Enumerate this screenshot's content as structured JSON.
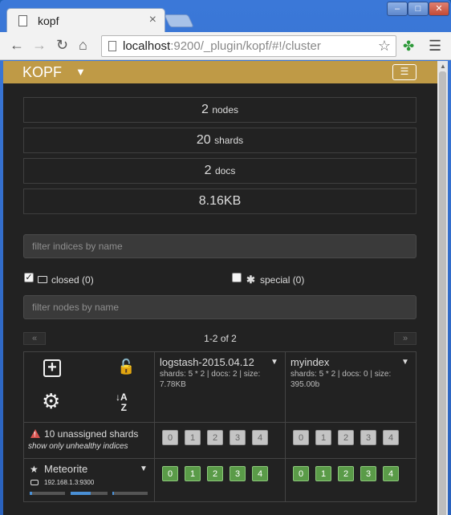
{
  "browser": {
    "tab_title": "kopf",
    "url_host": "localhost",
    "url_path": ":9200/_plugin/kopf/#!/cluster"
  },
  "app": {
    "brand": "KOPF"
  },
  "stats": {
    "nodes": {
      "value": "2",
      "unit": "nodes"
    },
    "shards": {
      "value": "20",
      "unit": "shards"
    },
    "docs": {
      "value": "2",
      "unit": "docs"
    },
    "size": {
      "value": "8.16KB"
    }
  },
  "filters": {
    "indices_placeholder": "filter indices by name",
    "nodes_placeholder": "filter nodes by name",
    "closed_label": "closed (0)",
    "closed_checked": true,
    "special_label": "special (0)",
    "special_checked": false
  },
  "pager": {
    "prev": "«",
    "next": "»",
    "text": "1-2 of 2"
  },
  "indices": [
    {
      "name": "logstash-2015.04.12",
      "meta_line1": "shards: 5 * 2 | docs: 2 | size:",
      "meta_line2": "7.78KB",
      "unassigned": [
        "0",
        "1",
        "2",
        "3",
        "4"
      ],
      "node_shards": [
        "0",
        "1",
        "2",
        "3",
        "4"
      ]
    },
    {
      "name": "myindex",
      "meta_line1": "shards: 5 * 2 | docs: 0 | size:",
      "meta_line2": "395.00b",
      "unassigned": [
        "0",
        "1",
        "2",
        "3",
        "4"
      ],
      "node_shards": [
        "0",
        "1",
        "2",
        "3",
        "4"
      ]
    }
  ],
  "unassigned_row": {
    "label": "10 unassigned shards",
    "link": "show only unhealthy indices"
  },
  "node": {
    "name": "Meteorite",
    "ip": "192.168.1.3:9300",
    "usage": [
      0.06,
      0.55,
      0.05
    ]
  },
  "colors": {
    "navbar": "#bf9a46",
    "background": "#222222",
    "shard_started": "#5a9b48",
    "shard_unassigned": "#c4c4c4",
    "warning": "#d9534f"
  }
}
